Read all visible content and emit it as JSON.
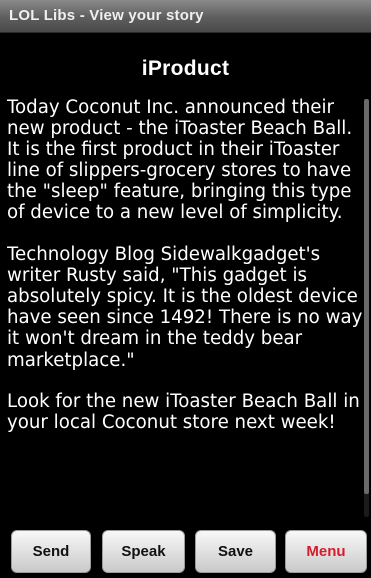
{
  "window": {
    "title": "LOL Libs - View your story"
  },
  "story": {
    "title": "iProduct",
    "paragraphs": [
      "Today Coconut Inc. announced their new product - the iToaster Beach Ball. It is the first product in their iToaster line of slippers-grocery stores to have the \"sleep\" feature, bringing this type of device to a new level of simplicity.",
      "Technology Blog Sidewalkgadget's writer Rusty said, \"This gadget is absolutely spicy.  It is the oldest device I have seen since 1492!  There is no way it won't dream in the teddy bear marketplace.\"",
      "Look for the new iToaster Beach Ball in your local Coconut store next week!"
    ]
  },
  "buttons": {
    "send": "Send",
    "speak": "Speak",
    "save": "Save",
    "menu": "Menu"
  },
  "colors": {
    "background": "#000000",
    "text": "#ffffff",
    "menu_label": "#d81b2b"
  }
}
